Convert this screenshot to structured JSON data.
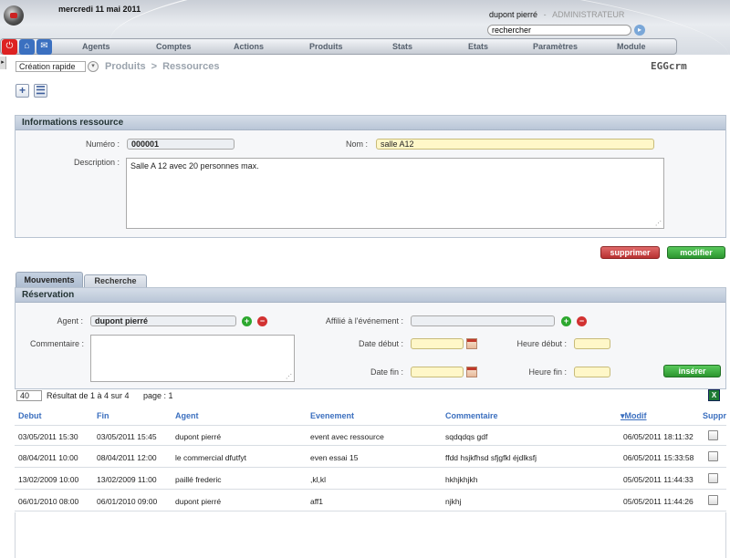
{
  "header": {
    "date": "mercredi 11 mai 2011",
    "user_name": "dupont pierré",
    "user_separator": "-",
    "user_role": "ADMINISTRATEUR",
    "search_value": "rechercher"
  },
  "nav": {
    "items": [
      "Agents",
      "Comptes",
      "Actions",
      "Produits",
      "Stats",
      "Etats",
      "Paramètres",
      "Module"
    ]
  },
  "toolbar": {
    "quick_create": "Création rapide",
    "breadcrumb": [
      "Produits",
      "Ressources"
    ],
    "breadcrumb_sep": ">",
    "brand": "EGGcrm"
  },
  "info_panel": {
    "title": "Informations ressource",
    "numero_label": "Numéro :",
    "numero_value": "000001",
    "nom_label": "Nom :",
    "nom_value": "salle A12",
    "description_label": "Description :",
    "description_value": "Salle A 12 avec 20 personnes max."
  },
  "actions": {
    "delete_label": "supprimer",
    "modify_label": "modifier"
  },
  "tabs": [
    "Mouvements",
    "Recherche"
  ],
  "reservation": {
    "title": "Réservation",
    "agent_label": "Agent :",
    "agent_value": "dupont pierré",
    "affilie_label": "Affilié à l'événement :",
    "affilie_value": "",
    "commentaire_label": "Commentaire :",
    "date_debut_label": "Date début :",
    "heure_debut_label": "Heure début :",
    "date_fin_label": "Date fin :",
    "heure_fin_label": "Heure fin :",
    "insert_label": "insérer"
  },
  "results": {
    "per_page": "40",
    "summary": "Résultat de 1 à 4 sur 4",
    "page": "page : 1",
    "excel_icon": "X"
  },
  "table": {
    "headers": [
      "Debut",
      "Fin",
      "Agent",
      "Evenement",
      "Commentaire",
      "Modif",
      "Suppr"
    ],
    "rows": [
      [
        "03/05/2011 15:30",
        "03/05/2011 15:45",
        "dupont pierré",
        "event avec ressource",
        "sqdqdqs gdf",
        "06/05/2011 18:11:32"
      ],
      [
        "08/04/2011 10:00",
        "08/04/2011 12:00",
        "le commercial dfutfyt",
        "even essai 15",
        "ffdd hsjkfhsd sfjgfkl éjdlksfj",
        "06/05/2011 15:33:58"
      ],
      [
        "13/02/2009 10:00",
        "13/02/2009 11:00",
        "paillé frederic",
        ",kl,kl",
        "hkhjkhjkh",
        "05/05/2011 11:44:33"
      ],
      [
        "06/01/2010 08:00",
        "06/01/2010 09:00",
        "dupont pierré",
        "aff1",
        "njkhj",
        "05/05/2011 11:44:26"
      ]
    ]
  }
}
